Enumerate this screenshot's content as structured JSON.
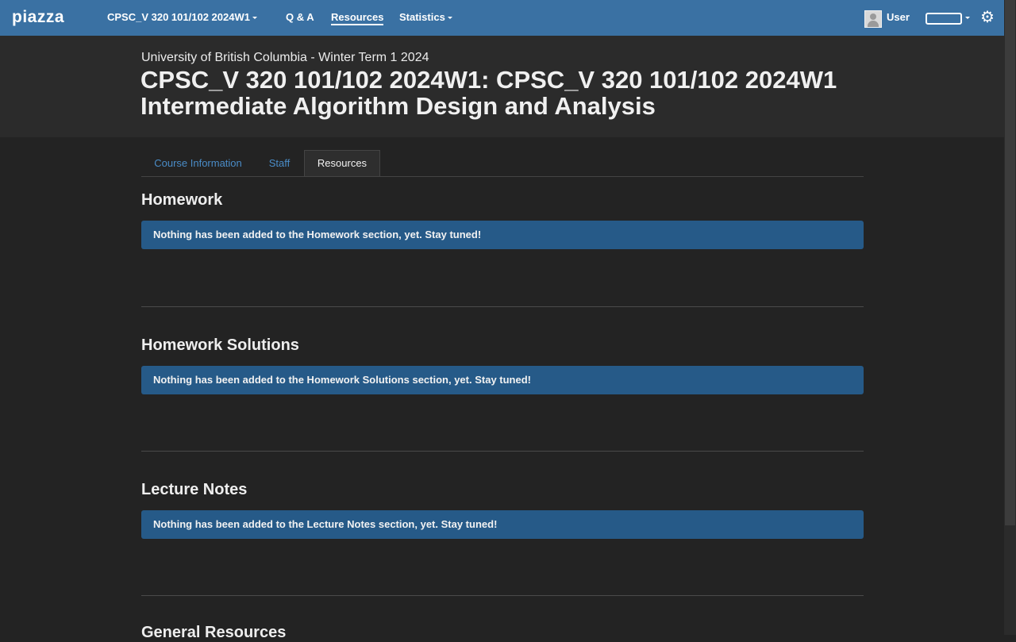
{
  "topbar": {
    "logo": "piazza",
    "course_selector": "CPSC_V 320 101/102 2024W1",
    "qa": "Q & A",
    "resources": "Resources",
    "statistics": "Statistics",
    "user": "User",
    "accent_color": "#3a71a3"
  },
  "header": {
    "term": "University of British Columbia - Winter Term 1 2024",
    "title": "CPSC_V 320 101/102 2024W1: CPSC_V 320 101/102 2024W1 Intermediate Algorithm Design and Analysis"
  },
  "tabs": {
    "course_info": "Course Information",
    "staff": "Staff",
    "resources": "Resources",
    "active": "Resources"
  },
  "sections": [
    {
      "title": "Homework",
      "notice": "Nothing has been added to the Homework section, yet. Stay tuned!"
    },
    {
      "title": "Homework Solutions",
      "notice": "Nothing has been added to the Homework Solutions section, yet. Stay tuned!"
    },
    {
      "title": "Lecture Notes",
      "notice": "Nothing has been added to the Lecture Notes section, yet. Stay tuned!"
    },
    {
      "title": "General Resources"
    }
  ],
  "icons": {
    "gear": "gear-icon",
    "avatar": "avatar"
  }
}
